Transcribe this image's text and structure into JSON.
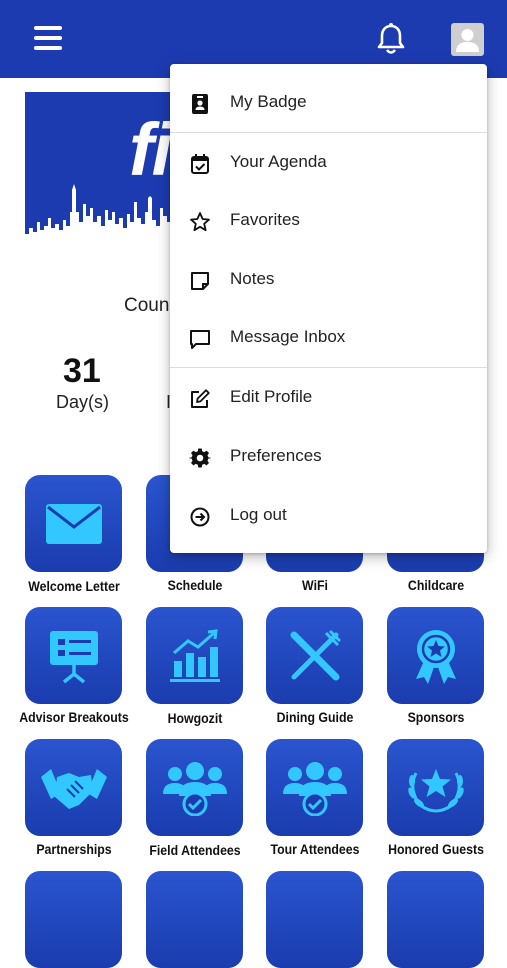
{
  "header": {
    "menu_icon": "hamburger-icon",
    "notifications_icon": "bell-icon",
    "profile_icon": "avatar-icon",
    "bar_color": "#1d3bb0"
  },
  "banner": {
    "logo_text": "fi"
  },
  "countdown": {
    "label": "Coun",
    "value": "31",
    "unit": "Day(s)",
    "next_unit_peek": "I"
  },
  "tiles": [
    {
      "label": "Welcome Letter",
      "icon": "envelope-icon"
    },
    {
      "label": "Schedule",
      "icon": "schedule-icon"
    },
    {
      "label": "WiFi",
      "icon": "wifi-icon"
    },
    {
      "label": "Childcare",
      "icon": "childcare-icon"
    },
    {
      "label": "Advisor Breakouts",
      "icon": "presentation-icon"
    },
    {
      "label": "Howgozit",
      "icon": "chart-icon"
    },
    {
      "label": "Dining Guide",
      "icon": "fork-knife-icon"
    },
    {
      "label": "Sponsors",
      "icon": "award-icon"
    },
    {
      "label": "Partnerships",
      "icon": "handshake-icon"
    },
    {
      "label": "Field Attendees",
      "icon": "group-check-icon"
    },
    {
      "label": "Tour Attendees",
      "icon": "group-check-icon"
    },
    {
      "label": "Honored Guests",
      "icon": "laurel-star-icon"
    }
  ],
  "user_menu": {
    "items": [
      {
        "label": "My Badge",
        "icon": "badge-icon"
      },
      {
        "label": "Your Agenda",
        "icon": "calendar-check-icon"
      },
      {
        "label": "Favorites",
        "icon": "star-icon"
      },
      {
        "label": "Notes",
        "icon": "note-icon"
      },
      {
        "label": "Message Inbox",
        "icon": "message-icon"
      },
      {
        "label": "Edit Profile",
        "icon": "edit-icon"
      },
      {
        "label": "Preferences",
        "icon": "gear-icon"
      },
      {
        "label": "Log out",
        "icon": "logout-icon"
      }
    ]
  },
  "colors": {
    "tile_top": "#2a55cf",
    "tile_bottom": "#1a3cae",
    "icon_accent": "#33c7ff"
  }
}
